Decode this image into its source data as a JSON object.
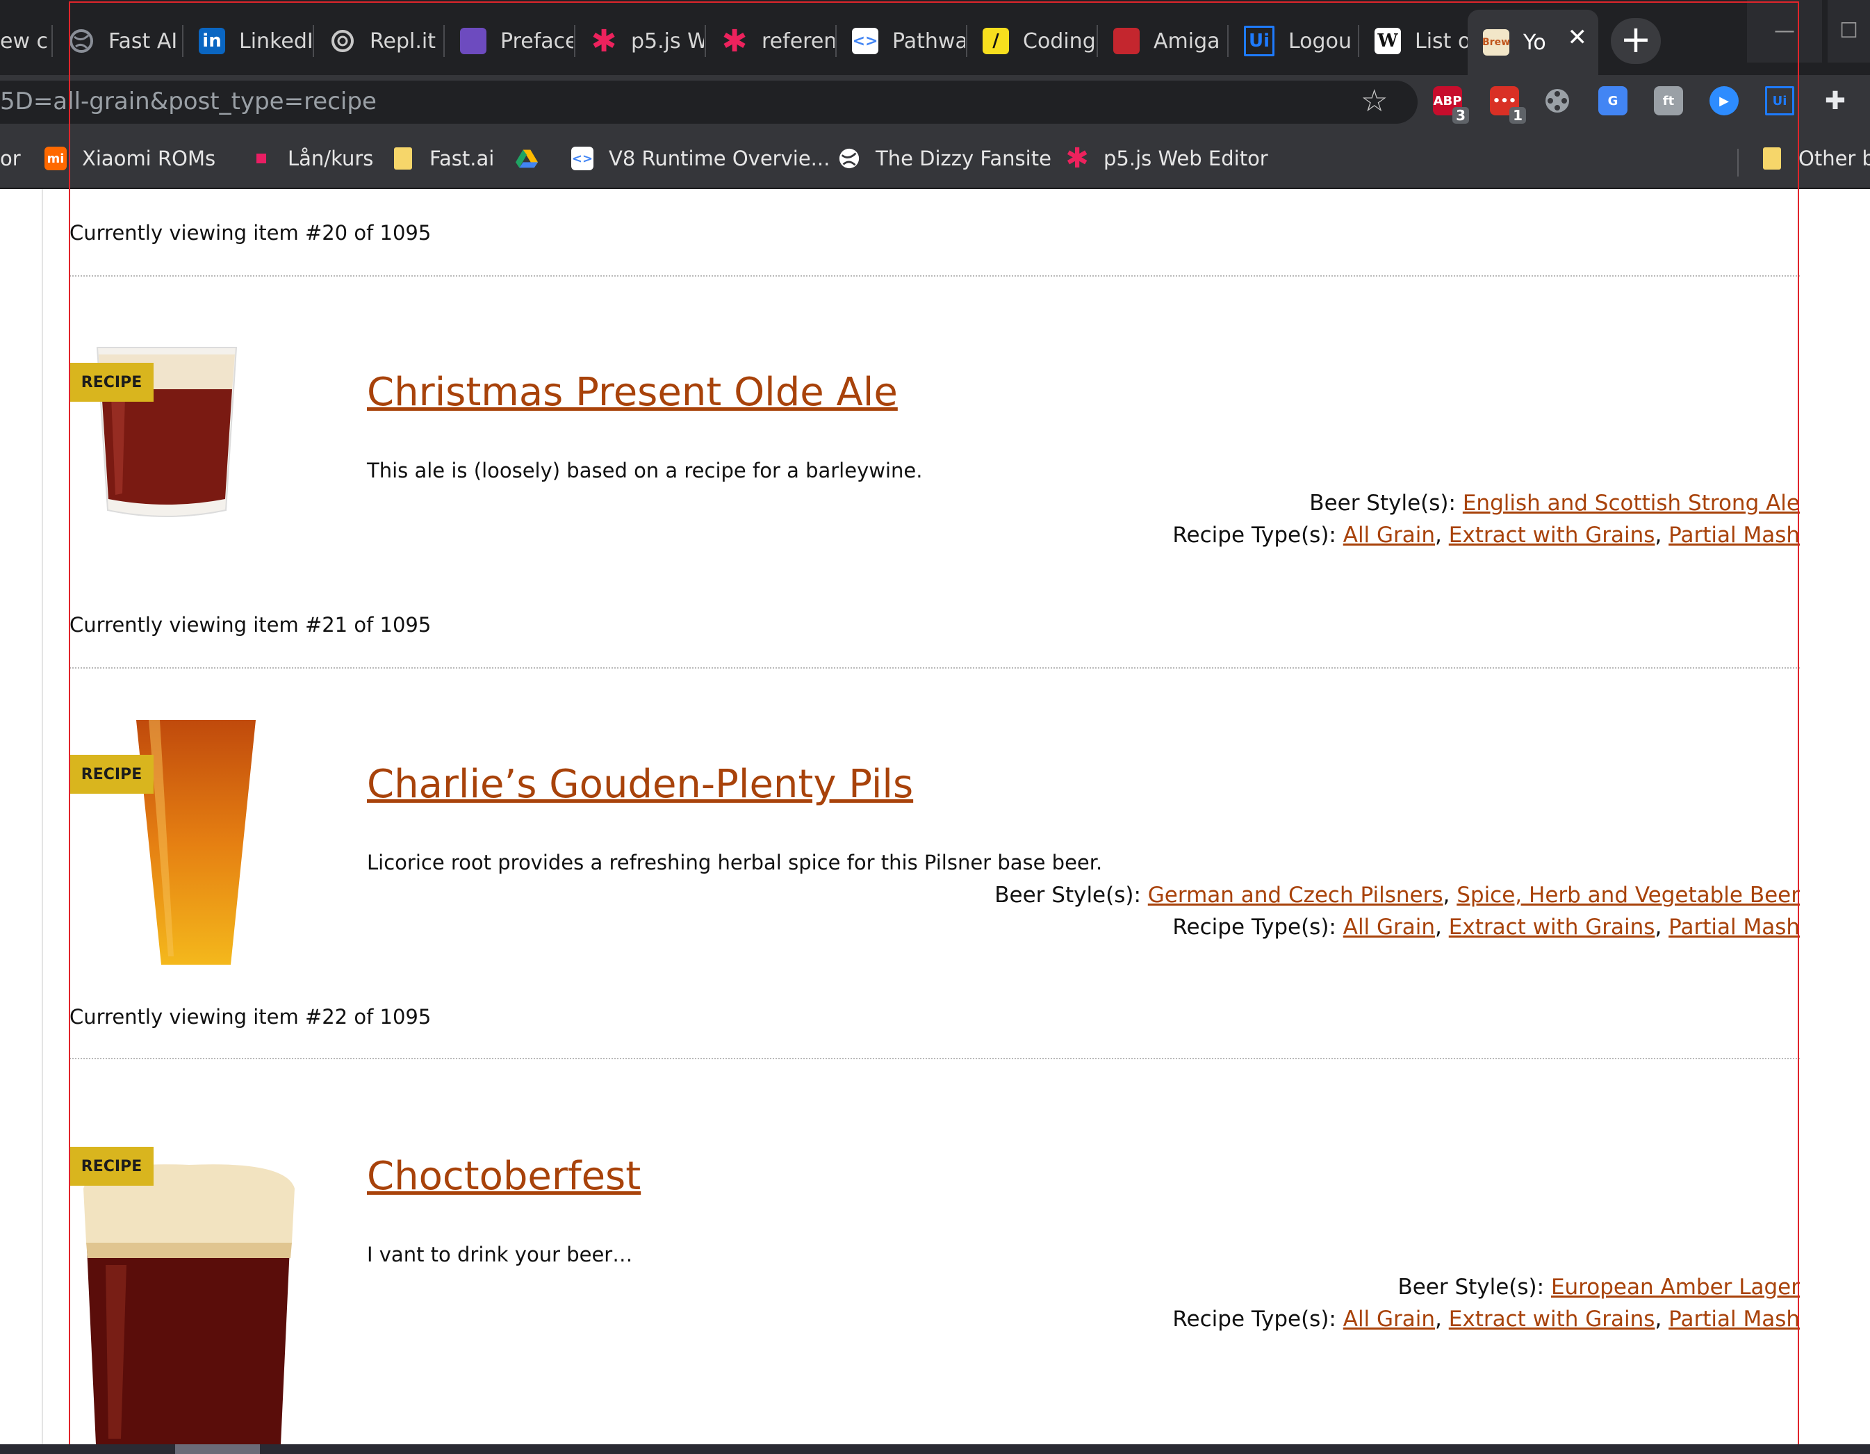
{
  "browser": {
    "tabs": [
      {
        "label": "ew c",
        "icon": "generic-page-icon",
        "color": "#5f6368"
      },
      {
        "label": "Fast AI",
        "icon": "globe-icon",
        "color": "#5f6368"
      },
      {
        "label": "LinkedIn",
        "icon": "linkedin-icon",
        "color": "#0a66c2"
      },
      {
        "label": "Repl.it",
        "icon": "replit-icon",
        "color": "#8a8f98"
      },
      {
        "label": "Preface",
        "icon": "preface-icon",
        "color": "#6d4bbf"
      },
      {
        "label": "p5.js W",
        "icon": "p5js-icon",
        "color": "#ed225d"
      },
      {
        "label": "referen",
        "icon": "p5js-icon",
        "color": "#ed225d"
      },
      {
        "label": "Pathwa",
        "icon": "code-icon",
        "color": "#ffffff"
      },
      {
        "label": "Coding",
        "icon": "coding-icon",
        "color": "#f7df1e"
      },
      {
        "label": "Amiga",
        "icon": "amiga-icon",
        "color": "#c4262e"
      },
      {
        "label": "Logou",
        "icon": "uipath-icon",
        "color": "#0067df"
      },
      {
        "label": "List of",
        "icon": "wikipedia-icon",
        "color": "#ffffff"
      },
      {
        "label": "Yo",
        "icon": "brew-site-icon",
        "color": "#f2e6c8",
        "active": true
      }
    ],
    "address_bar": {
      "url_fragment": "5D=all-grain&post_type=recipe"
    },
    "extensions": [
      {
        "name": "adblock-plus-icon",
        "label": "ABP",
        "count": "3",
        "color": "#c70d2c"
      },
      {
        "name": "red-extension-icon",
        "label": "•••",
        "count": "1",
        "color": "#d93025"
      },
      {
        "name": "film-reel-icon",
        "label": "",
        "count": "",
        "color": "#9aa0a6"
      },
      {
        "name": "google-translate-icon",
        "label": "G",
        "count": "",
        "color": "#4285f4"
      },
      {
        "name": "font-extension-icon",
        "label": "ft",
        "count": "",
        "color": "#9aa0a6"
      },
      {
        "name": "zoom-icon",
        "label": "▶",
        "count": "",
        "color": "#2d8cff"
      },
      {
        "name": "uipath-icon",
        "label": "Ui",
        "count": "",
        "color": "#0067df"
      },
      {
        "name": "puzzle-icon",
        "label": "✚",
        "count": "",
        "color": "#e8eaed"
      }
    ],
    "bookmarks": [
      {
        "label": "or",
        "icon": "",
        "color": "#e6e6e6"
      },
      {
        "label": "Xiaomi ROMs",
        "icon": "xiaomi-icon",
        "color": "#ff6900"
      },
      {
        "label": "Lån/kurs",
        "icon": "pink-square-icon",
        "color": "#e91e63"
      },
      {
        "label": "Fast.ai",
        "icon": "folder-icon",
        "color": "#f6d66a"
      },
      {
        "label": "",
        "icon": "google-drive-icon",
        "color": "#1fa463"
      },
      {
        "label": "V8 Runtime Overvie...",
        "icon": "code-icon",
        "color": "#ffffff"
      },
      {
        "label": "The Dizzy Fansite",
        "icon": "globe-icon",
        "color": "#ffffff"
      },
      {
        "label": "p5.js Web Editor",
        "icon": "p5js-icon",
        "color": "#ed225d"
      }
    ],
    "other_bookmarks": "Other b"
  },
  "page": {
    "badge_label": "RECIPE",
    "style_label": "Beer Style(s):",
    "type_label": "Recipe Type(s):",
    "link_color": "#a8420a",
    "badge_color": "#d9b51e",
    "items": [
      {
        "viewing": "Currently viewing item #20 of 1095",
        "title": "Christmas Present Olde Ale",
        "description": "This ale is (loosely) based on a recipe for a barleywine.",
        "styles": [
          "English and Scottish Strong Ale"
        ],
        "types": [
          "All Grain",
          "Extract with Grains",
          "Partial Mash"
        ],
        "image": "dark-ale-rocks-glass"
      },
      {
        "viewing": "Currently viewing item #21 of 1095",
        "title": "Charlie’s Gouden-Plenty Pils",
        "description": "Licorice root provides a refreshing herbal spice for this Pilsner base beer.",
        "styles": [
          "German and Czech Pilsners",
          "Spice, Herb and Vegetable Beer"
        ],
        "types": [
          "All Grain",
          "Extract with Grains",
          "Partial Mash"
        ],
        "image": "pilsner-tall-glass"
      },
      {
        "viewing": "Currently viewing item #22 of 1095",
        "title": "Choctoberfest",
        "description": "I vant to drink your beer…",
        "styles": [
          "European Amber Lager"
        ],
        "types": [
          "All Grain",
          "Extract with Grains",
          "Partial Mash"
        ],
        "image": "amber-pint-glass"
      }
    ]
  }
}
